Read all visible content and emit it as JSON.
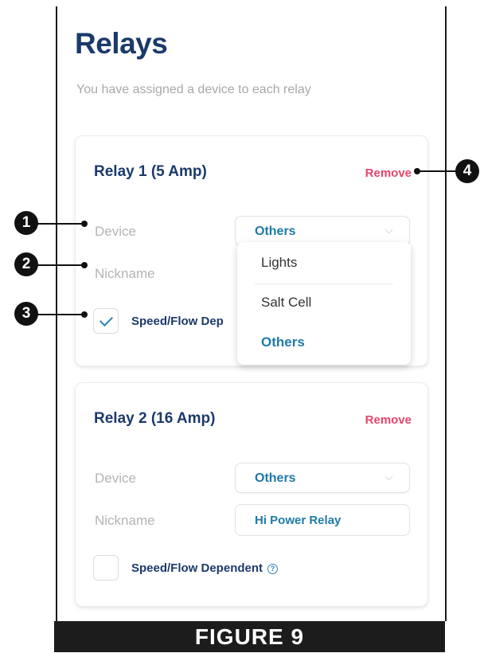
{
  "header": {
    "title": "Relays",
    "subtitle": "You have assigned a device to each relay"
  },
  "relays": [
    {
      "title": "Relay 1 (5 Amp)",
      "remove_label": "Remove",
      "device_label": "Device",
      "device_value": "Others",
      "nickname_label": "Nickname",
      "nickname_value": "",
      "speed_flow_label": "Speed/Flow Dep",
      "speed_flow_checked": true
    },
    {
      "title": "Relay 2 (16 Amp)",
      "remove_label": "Remove",
      "device_label": "Device",
      "device_value": "Others",
      "nickname_label": "Nickname",
      "nickname_value": "Hi Power Relay",
      "speed_flow_label": "Speed/Flow Dependent",
      "speed_flow_checked": false,
      "help_icon": "?"
    }
  ],
  "device_dropdown": {
    "options": [
      "Lights",
      "Salt Cell",
      "Others"
    ],
    "selected": "Others"
  },
  "callouts": [
    "1",
    "2",
    "3",
    "4"
  ],
  "figure_caption": "FIGURE 9",
  "colors": {
    "title": "#1b3a6b",
    "accent": "#1e7aa8",
    "remove": "#e4456b",
    "label": "#b4b4b4"
  }
}
